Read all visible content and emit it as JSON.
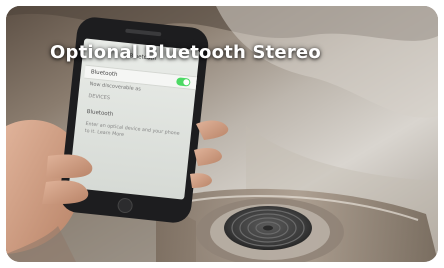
{
  "caption": "Optional Bluetooth Stereo",
  "phone_screen": {
    "nav_title": "Bluetooth",
    "rows": [
      {
        "label": "Bluetooth",
        "toggle_on": true
      },
      {
        "label": "Now discoverable as"
      },
      {
        "label": "DEVICES"
      }
    ],
    "section": "Bluetooth",
    "footer_text": "Enter an optical device and your phone to it. Learn More"
  },
  "colors": {
    "toggle_on": "#4cd964",
    "caption_text": "#ffffff"
  }
}
